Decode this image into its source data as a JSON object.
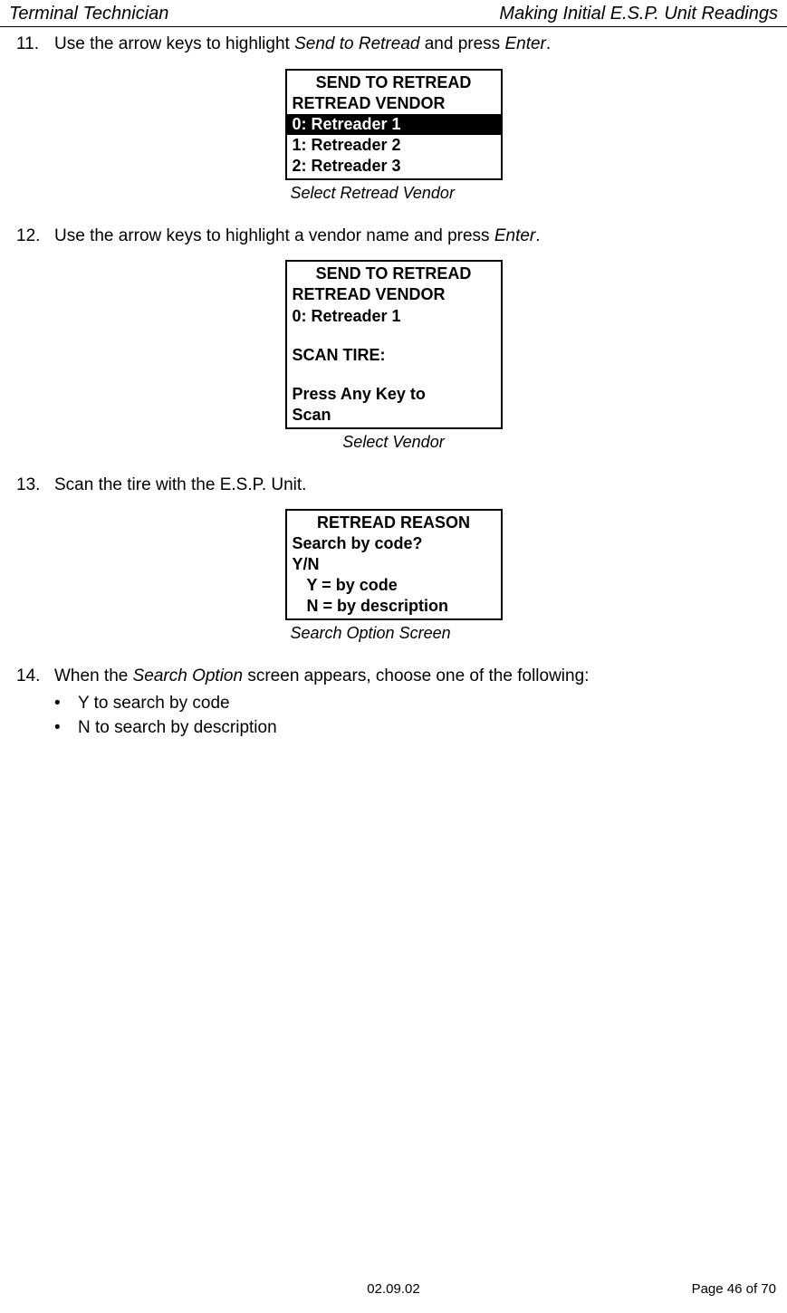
{
  "header": {
    "left": "Terminal Technician",
    "right": "Making Initial E.S.P. Unit Readings"
  },
  "steps": {
    "s11": {
      "num": "11.",
      "pre": "Use the arrow keys to highlight ",
      "italic1": "Send to Retread",
      "mid": " and press ",
      "italic2": "Enter",
      "post": "."
    },
    "s12": {
      "num": "12.",
      "pre": "Use the arrow keys to highlight a vendor name and press ",
      "italic1": "Enter",
      "post": "."
    },
    "s13": {
      "num": "13.",
      "text": "Scan the tire with the E.S.P. Unit."
    },
    "s14": {
      "num": "14.",
      "pre": "When the ",
      "italic1": "Search Option",
      "post": " screen appears, choose one of the following:",
      "bullets": [
        "Y to search by code",
        "N to search by description"
      ]
    }
  },
  "screens": {
    "one": {
      "title": "SEND TO RETREAD",
      "line1": "RETREAD VENDOR",
      "highlighted": "0: Retreader 1",
      "line2": "1: Retreader 2",
      "line3": "2: Retreader 3",
      "caption": "Select Retread Vendor"
    },
    "two": {
      "title": "SEND TO RETREAD",
      "line1": "RETREAD VENDOR",
      "line2": "0: Retreader 1",
      "line3": "SCAN TIRE:",
      "line4": "Press Any Key to",
      "line5": "Scan",
      "caption": "Select Vendor"
    },
    "three": {
      "title": "RETREAD REASON",
      "line1": "Search by code?",
      "line2": "Y/N",
      "line3": "Y = by code",
      "line4": "N = by description",
      "caption": "Search Option Screen"
    }
  },
  "footer": {
    "date": "02.09.02",
    "page": "Page 46 of 70"
  }
}
